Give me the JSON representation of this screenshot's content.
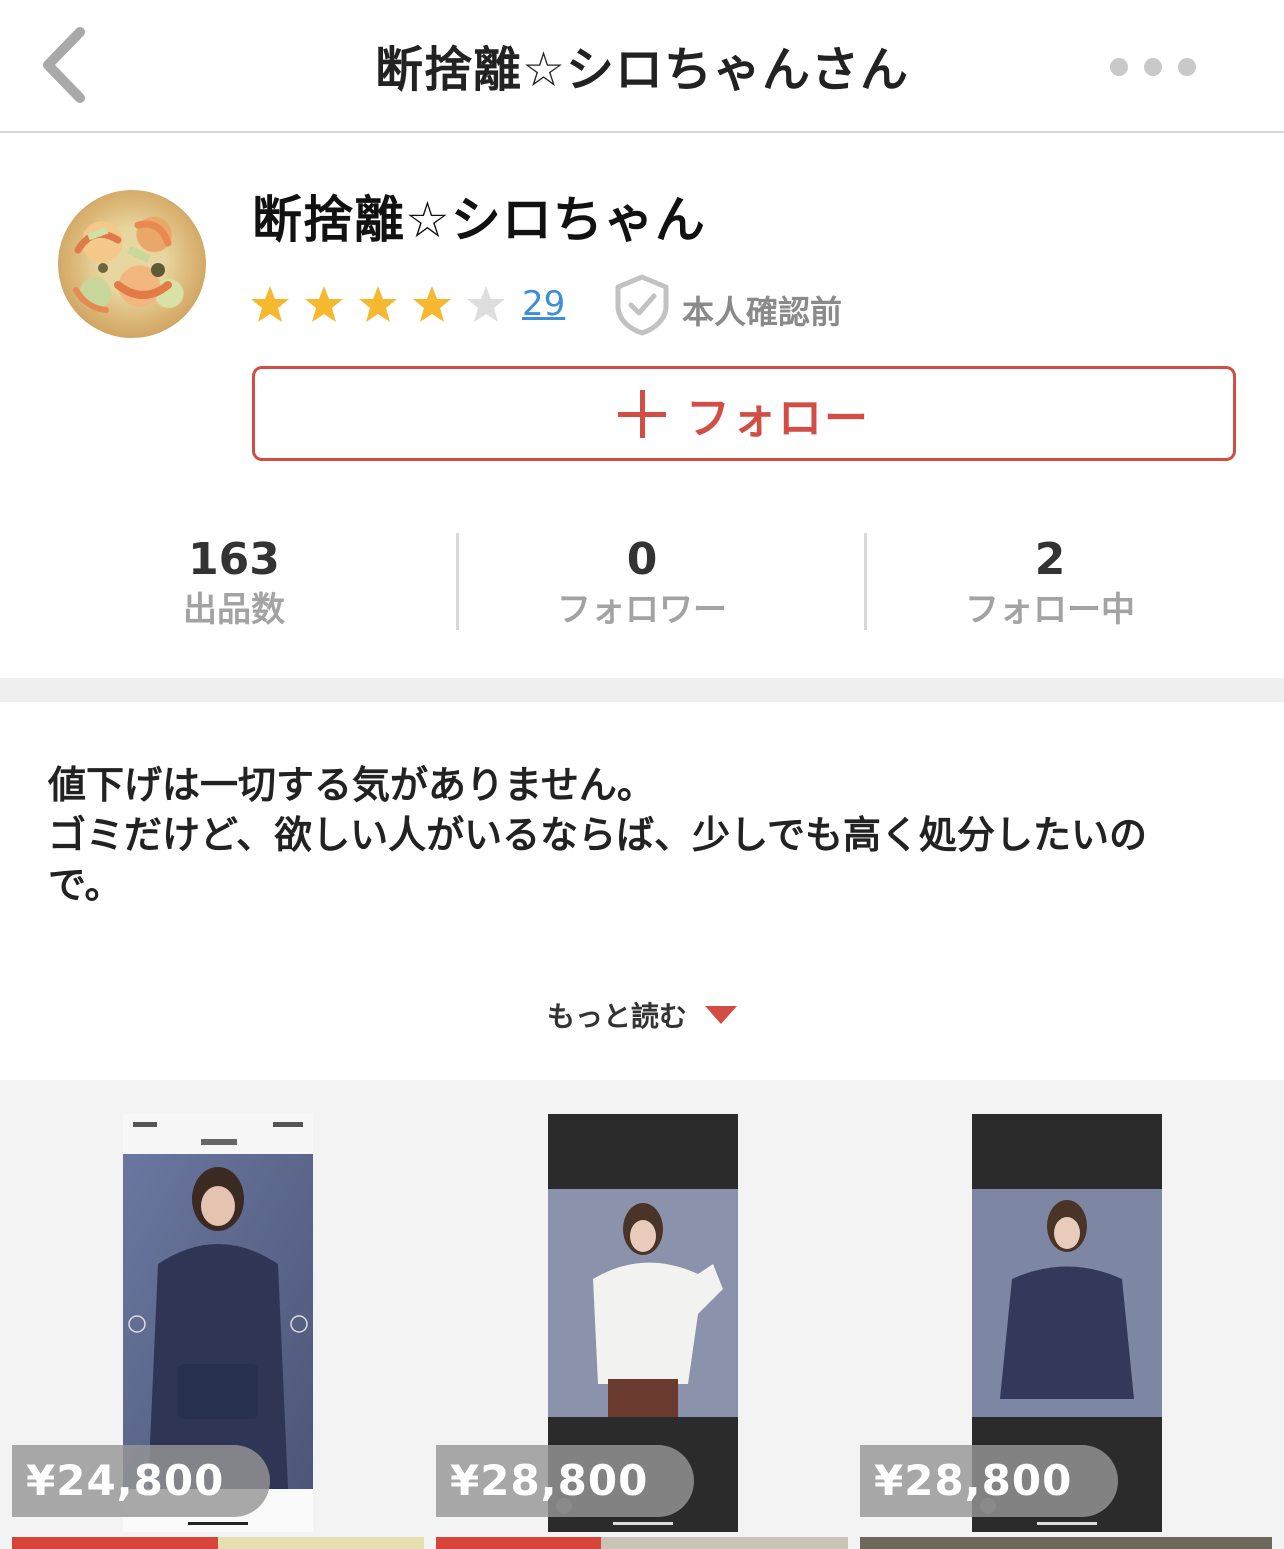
{
  "header": {
    "title": "断捨離☆シロちゃんさん"
  },
  "profile": {
    "name": "断捨離☆シロちゃん",
    "rating": 4,
    "rating_max": 5,
    "review_count": "29",
    "verification": "本人確認前",
    "follow_label": "フォロー"
  },
  "stats": [
    {
      "value": "163",
      "label": "出品数"
    },
    {
      "value": "0",
      "label": "フォロワー"
    },
    {
      "value": "2",
      "label": "フォロー中"
    }
  ],
  "bio": {
    "line1": "値下げは一切する気がありません。",
    "line2": "ゴミだけど、欲しい人がいるならば、少しでも高く処分したいの",
    "line3": "で。",
    "read_more": "もっと読む"
  },
  "items": [
    {
      "price": "¥24,800"
    },
    {
      "price": "¥28,800"
    },
    {
      "price": "¥28,800"
    }
  ],
  "colors": {
    "accent": "#d24d43",
    "star": "#f5b82e",
    "link": "#3b8ed8"
  }
}
